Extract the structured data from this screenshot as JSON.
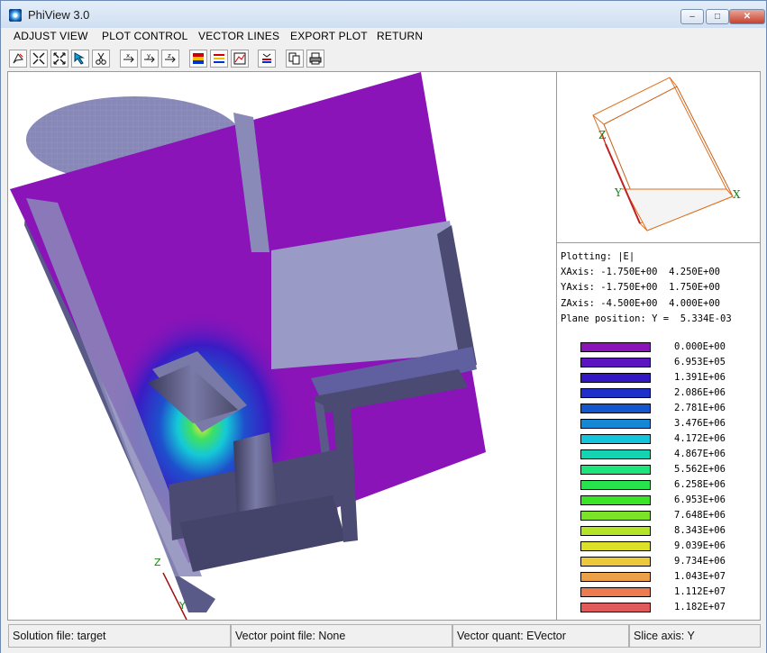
{
  "window": {
    "title": "PhiView 3.0"
  },
  "titlebar_buttons": {
    "minimize": "–",
    "maximize": "□",
    "close": "✕"
  },
  "menu": [
    "ADJUST VIEW",
    "PLOT CONTROL",
    "VECTOR LINES",
    "EXPORT PLOT",
    "RETURN"
  ],
  "toolbar_icons": [
    "rotate-icon",
    "zoom-in-icon",
    "zoom-out-icon",
    "pointer-icon",
    "scissors-icon",
    "x-axis-icon",
    "y-axis-icon",
    "z-axis-icon",
    "color-fill-icon",
    "contour-lines-icon",
    "surface-icon",
    "legend-icon",
    "copy-icon",
    "print-icon"
  ],
  "orientation": {
    "x_label": "X",
    "y_label": "Y",
    "z_label": "Z"
  },
  "plot_axes": {
    "z_label": "Z",
    "y_label": "Y"
  },
  "info": {
    "plotting": "Plotting: |E|",
    "xaxis": "XAxis: -1.750E+00  4.250E+00",
    "yaxis": "YAxis: -1.750E+00  1.750E+00",
    "zaxis": "ZAxis: -4.500E+00  4.000E+00",
    "plane": "Plane position: Y =  5.334E-03"
  },
  "legend": [
    {
      "value": "0.000E+00",
      "color": "#8a14b8"
    },
    {
      "value": "6.953E+05",
      "color": "#5a14c0"
    },
    {
      "value": "1.391E+06",
      "color": "#3418c4"
    },
    {
      "value": "2.086E+06",
      "color": "#1e30c8"
    },
    {
      "value": "2.781E+06",
      "color": "#1456cc"
    },
    {
      "value": "3.476E+06",
      "color": "#1488d4"
    },
    {
      "value": "4.172E+06",
      "color": "#14c4dc"
    },
    {
      "value": "4.867E+06",
      "color": "#14d4b4"
    },
    {
      "value": "5.562E+06",
      "color": "#1ee47c"
    },
    {
      "value": "6.258E+06",
      "color": "#28e44c"
    },
    {
      "value": "6.953E+06",
      "color": "#3ce428"
    },
    {
      "value": "7.648E+06",
      "color": "#7ce428"
    },
    {
      "value": "8.343E+06",
      "color": "#b4e428"
    },
    {
      "value": "9.039E+06",
      "color": "#dce028"
    },
    {
      "value": "9.734E+06",
      "color": "#ecc83c"
    },
    {
      "value": "1.043E+07",
      "color": "#eca048"
    },
    {
      "value": "1.112E+07",
      "color": "#ec7c50"
    },
    {
      "value": "1.182E+07",
      "color": "#e05a5a"
    }
  ],
  "status": {
    "solution_file": "Solution file: target",
    "vector_point_file": "Vector point file: None",
    "vector_quant": "Vector quant: EVector",
    "slice_axis": "Slice axis: Y"
  }
}
